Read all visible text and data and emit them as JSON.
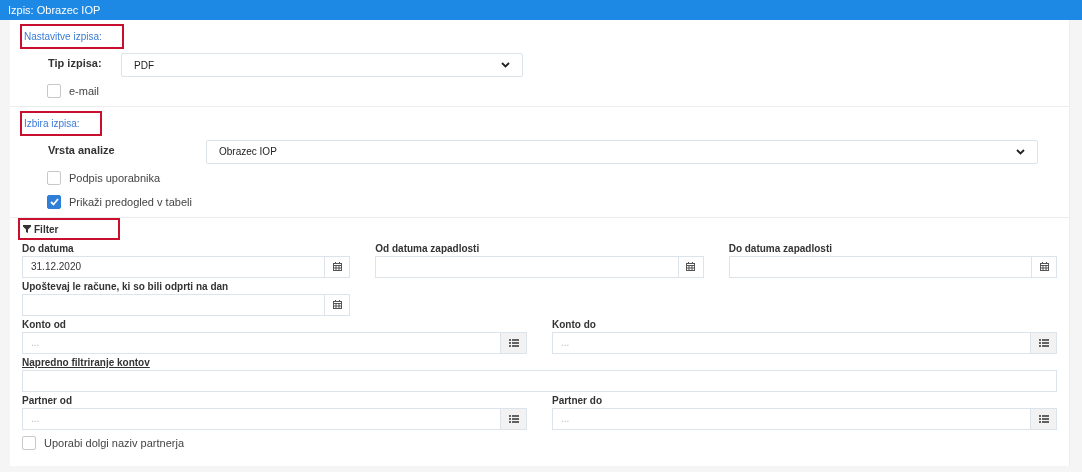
{
  "window": {
    "title": "Izpis: Obrazec IOP"
  },
  "sections": [
    {
      "heading": "Nastavitve izpisa:",
      "fields": [
        {
          "kind": "select",
          "label": "Tip izpisa:",
          "value": "PDF"
        },
        {
          "kind": "checkbox",
          "label": "e-mail",
          "checked": false
        }
      ]
    },
    {
      "heading": "Izbira izpisa:",
      "fields": [
        {
          "kind": "wide-select",
          "label": "Vrsta analize",
          "value": "Obrazec IOP"
        },
        {
          "kind": "checkbox",
          "label": "Podpis uporabnika",
          "checked": false
        },
        {
          "kind": "checkbox",
          "label": "Prikaži predogled v tabeli",
          "checked": true
        }
      ]
    }
  ],
  "filter": {
    "heading": "Filter",
    "rows": [
      {
        "kind": "thirds",
        "fields": [
          {
            "kind": "date",
            "label": "Do datuma",
            "value": "31.12.2020"
          },
          {
            "kind": "date",
            "label": "Od datuma zapadlosti"
          },
          {
            "kind": "date",
            "label": "Do datuma zapadlosti"
          }
        ]
      },
      {
        "kind": "thirds",
        "fields": [
          {
            "kind": "date",
            "label": "Upoštevaj le račune, ki so bili odprti na dan"
          }
        ]
      },
      {
        "kind": "halves",
        "fields": [
          {
            "kind": "lookup",
            "label": "Konto od",
            "placeholder": "..."
          },
          {
            "kind": "lookup",
            "label": "Konto do",
            "placeholder": "..."
          }
        ]
      },
      {
        "kind": "full",
        "fields": [
          {
            "kind": "text",
            "label": "Napredno filtriranje kontov"
          }
        ]
      },
      {
        "kind": "halves",
        "fields": [
          {
            "kind": "lookup",
            "label": "Partner od",
            "placeholder": "..."
          },
          {
            "kind": "lookup",
            "label": "Partner do",
            "placeholder": "..."
          }
        ]
      }
    ],
    "checkbox": {
      "label": "Uporabi dolgi naziv partnerja",
      "checked": false
    }
  }
}
